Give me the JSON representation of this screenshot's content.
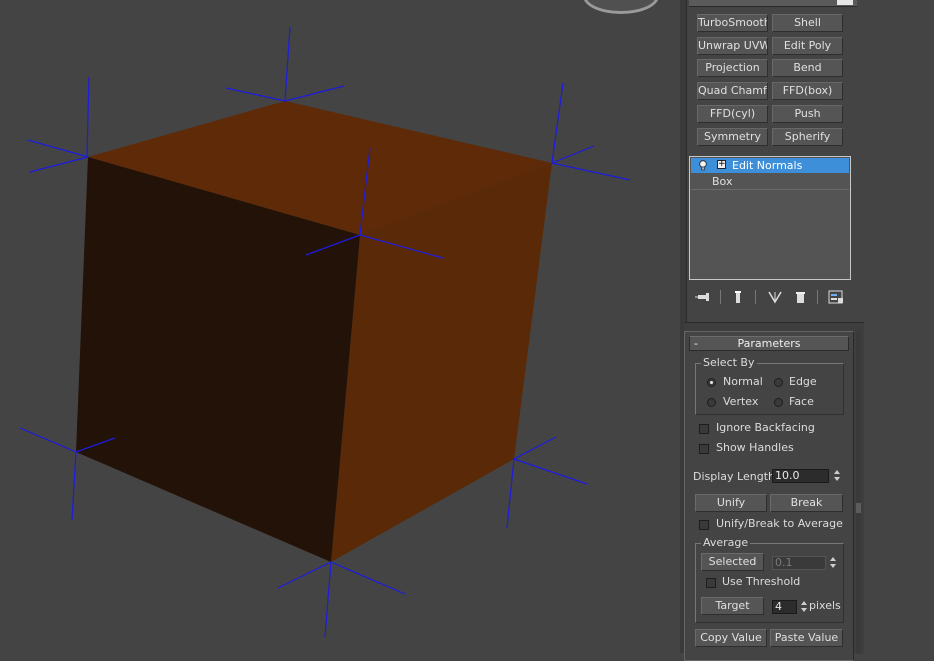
{
  "modifier_buttons": [
    {
      "id": "turbosmooth",
      "label": "TurboSmooth"
    },
    {
      "id": "shell",
      "label": "Shell"
    },
    {
      "id": "unwrap-uvw",
      "label": "Unwrap UVW"
    },
    {
      "id": "edit-poly",
      "label": "Edit Poly"
    },
    {
      "id": "projection",
      "label": "Projection"
    },
    {
      "id": "bend",
      "label": "Bend"
    },
    {
      "id": "quad-chamfer",
      "label": "Quad Chamfer"
    },
    {
      "id": "ffd-box",
      "label": "FFD(box)"
    },
    {
      "id": "ffd-cyl",
      "label": "FFD(cyl)"
    },
    {
      "id": "push",
      "label": "Push"
    },
    {
      "id": "symmetry",
      "label": "Symmetry"
    },
    {
      "id": "spherify",
      "label": "Spherify"
    }
  ],
  "stack": {
    "selected": "Edit Normals",
    "base": "Box",
    "expand_symbol": "+"
  },
  "stack_tools": [
    "pin-stack-icon",
    "show-end-result-icon",
    "make-unique-icon",
    "remove-modifier-icon",
    "configure-sets-icon"
  ],
  "parameters": {
    "title": "Parameters",
    "collapse_symbol": "-",
    "select_by": {
      "title": "Select By",
      "normal": "Normal",
      "edge": "Edge",
      "vertex": "Vertex",
      "face": "Face",
      "selected": "Normal"
    },
    "ignore_backfacing": "Ignore Backfacing",
    "show_handles": "Show Handles",
    "display_length_label": "Display Length:",
    "display_length_value": "10.0",
    "unify": "Unify",
    "break": "Break",
    "unify_break_average": "Unify/Break to Average",
    "average": {
      "title": "Average",
      "selected_button": "Selected",
      "selected_value": "0.1",
      "use_threshold": "Use Threshold",
      "target_button": "Target",
      "target_value": "4",
      "target_unit": "pixels"
    },
    "copy_value": "Copy Value",
    "paste_value": "Paste Value"
  },
  "colors": {
    "cube_top": "#5e2a07",
    "cube_right": "#5a2a08",
    "cube_front": "#231208",
    "normals": "#1c1ce0",
    "viewport_bg": "#444444",
    "selection": "#3c8fd8"
  }
}
